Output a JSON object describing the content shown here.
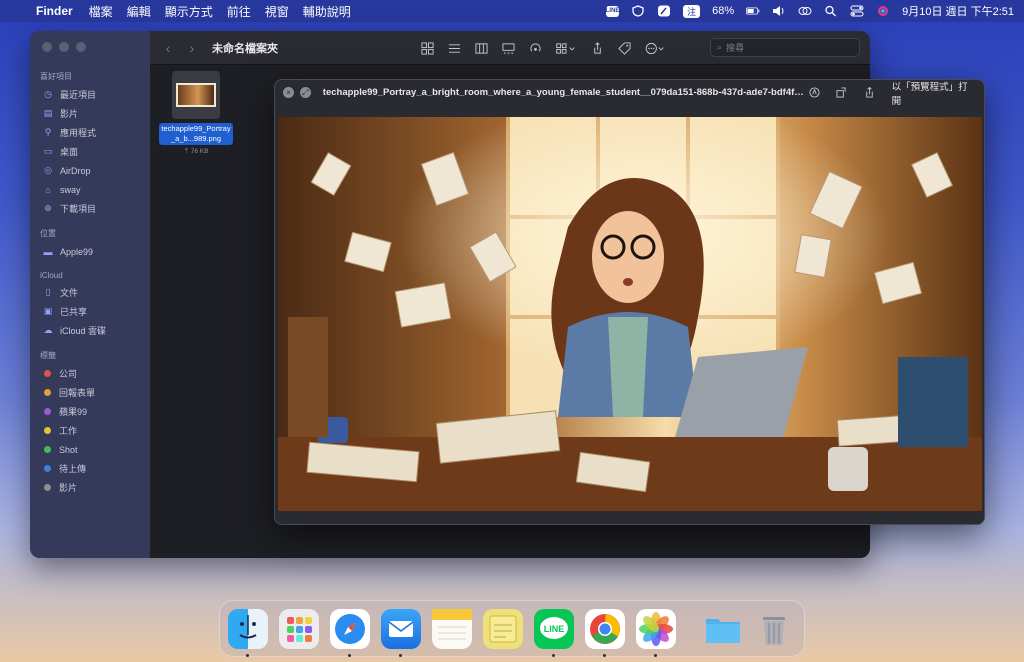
{
  "menubar": {
    "app_name": "Finder",
    "menus": [
      "檔案",
      "編輯",
      "顯示方式",
      "前往",
      "視窗",
      "輔助說明"
    ],
    "battery": "68%",
    "input_method": "注",
    "datetime": "9月10日 週日 下午2:51",
    "line_label": "LINE"
  },
  "finder": {
    "title": "未命名檔案夾",
    "search_placeholder": "搜尋",
    "sidebar": {
      "favorites_header": "喜好項目",
      "favorites": [
        "最近項目",
        "影片",
        "應用程式",
        "桌面",
        "AirDrop",
        "sway",
        "下載項目"
      ],
      "locations_header": "位置",
      "locations": [
        "Apple99"
      ],
      "icloud_header": "iCloud",
      "icloud": [
        "文件",
        "已共享",
        "iCloud 雲碟"
      ],
      "tags_header": "標籤",
      "tags": [
        {
          "label": "公司",
          "color": "#e0524c"
        },
        {
          "label": "回報表單",
          "color": "#e2a03a"
        },
        {
          "label": "蘋果99",
          "color": "#9a5bd6"
        },
        {
          "label": "工作",
          "color": "#e0c33a"
        },
        {
          "label": "Shot",
          "color": "#3fbf5a"
        },
        {
          "label": "待上傳",
          "color": "#3a82e0"
        },
        {
          "label": "影片",
          "color": "#8e8e93"
        }
      ]
    },
    "file": {
      "name": "techapple99_Portray_a_b...989.png",
      "size": "76 KB"
    }
  },
  "quicklook": {
    "title": "techapple99_Portray_a_bright_room_where_a_young_female_student__079da151-868b-437d-ade7-bdf4f43f...",
    "open_with": "以「預覽程式」打開"
  },
  "dock": {
    "apps": [
      "finder",
      "launchpad",
      "safari",
      "mail",
      "notes",
      "stickies",
      "line",
      "chrome",
      "photos"
    ],
    "extras": [
      "downloads-folder",
      "trash"
    ]
  }
}
